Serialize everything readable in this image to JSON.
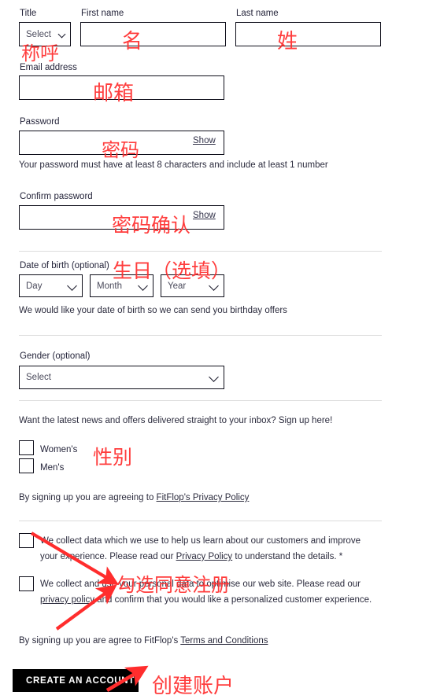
{
  "form": {
    "fields": {
      "title": {
        "label": "Title",
        "value": "Select"
      },
      "first_name": {
        "label": "First name",
        "value": ""
      },
      "last_name": {
        "label": "Last name",
        "value": ""
      },
      "email": {
        "label": "Email address",
        "value": ""
      },
      "password": {
        "label": "Password",
        "value": "",
        "show_label": "Show"
      },
      "confirm_password": {
        "label": "Confirm password",
        "value": "",
        "show_label": "Show"
      },
      "dob": {
        "label": "Date of birth (optional)",
        "day": "Day",
        "month": "Month",
        "year": "Year"
      },
      "gender": {
        "label": "Gender (optional)",
        "value": "Select"
      }
    },
    "helpers": {
      "password_rule": "Your password must have at least 8 characters and include at least 1 number",
      "dob_reason": "We would like your date of birth so we can send you birthday offers"
    },
    "newsletter": {
      "prompt": "Want the latest news and offers delivered straight to your inbox? Sign up here!",
      "options": [
        {
          "label": "Women's",
          "checked": false
        },
        {
          "label": "Men's",
          "checked": false
        }
      ],
      "agreement_prefix": "By signing up you are agreeing to ",
      "agreement_link": "FitFlop's Privacy Policy"
    },
    "consents": [
      {
        "checked": false,
        "text_before": "We collect data which we use to help us learn about our customers and improve your experience. Please read our ",
        "link": "Privacy Policy",
        "text_after": " to understand the details. *"
      },
      {
        "checked": false,
        "text_before": "We collect and use your personal data to optimise our web site. Please read our ",
        "link": "privacy policy",
        "text_after": " and confirm that you would like a personalized customer experience."
      }
    ],
    "terms": {
      "prefix": "By signing up you are agree to FitFlop's ",
      "link": "Terms and Conditions"
    },
    "submit_label": "CREATE AN ACCOUNT"
  },
  "annotations": {
    "color": "#ff2d2d",
    "notes": [
      {
        "text": "称呼"
      },
      {
        "text": "名"
      },
      {
        "text": "姓"
      },
      {
        "text": "邮箱"
      },
      {
        "text": "密码"
      },
      {
        "text": "密码确认"
      },
      {
        "text": "生日（选填）"
      },
      {
        "text": "性别"
      },
      {
        "text": "勾选同意注册"
      },
      {
        "text": "创建账户"
      }
    ]
  }
}
